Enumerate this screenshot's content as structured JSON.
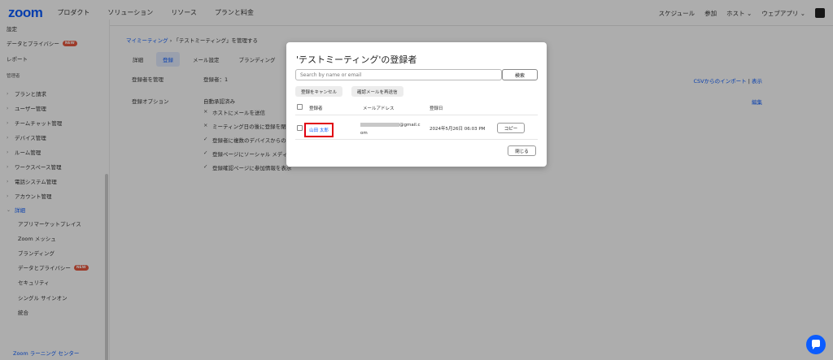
{
  "nav": {
    "logo": "zoom",
    "items": [
      "プロダクト",
      "ソリューション",
      "リソース",
      "プランと料金"
    ],
    "right": [
      "スケジュール",
      "参加",
      "ホスト ⌄",
      "ウェブアプリ ⌄"
    ]
  },
  "sidebar": {
    "top_items": [
      {
        "label": "設定"
      },
      {
        "label": "データとプライバシー",
        "badge": "NEW"
      },
      {
        "label": "レポート"
      }
    ],
    "section": "管理者",
    "admin_items": [
      "プランと請求",
      "ユーザー管理",
      "チームチャット管理",
      "デバイス管理",
      "ルーム管理",
      "ワークスペース管理",
      "電話システム管理",
      "アカウント管理"
    ],
    "advanced": "詳細",
    "advanced_items": [
      {
        "label": "アプリマーケットプレイス"
      },
      {
        "label": "Zoom メッシュ"
      },
      {
        "label": "ブランディング"
      },
      {
        "label": "データとプライバシー",
        "badge": "NEW"
      },
      {
        "label": "セキュリティ"
      },
      {
        "label": "シングル サインオン"
      },
      {
        "label": "統合"
      }
    ],
    "learning": "Zoom ラーニング センター"
  },
  "main": {
    "breadcrumb_link": "マイミーティング",
    "breadcrumb_sep": "›",
    "breadcrumb_current": "「テストミーティング」を管理する",
    "tabs": [
      "詳細",
      "登録",
      "メール設定",
      "ブランディング"
    ],
    "manage_label": "登録者を管理",
    "manage_value": "登録者：1",
    "options_label": "登録オプション",
    "options_head": "自動承認済み",
    "options": [
      {
        "mark": "×",
        "text": "ホストにメールを送信"
      },
      {
        "mark": "×",
        "text": "ミーティング日の後に登録を閉じ"
      },
      {
        "mark": "✓",
        "text": "登録者に複数のデバイスからの参"
      },
      {
        "mark": "✓",
        "text": "登録ページにソーシャル メディア"
      },
      {
        "mark": "✓",
        "text": "登録確認ページに参加情報を表示"
      }
    ],
    "csv_link": "CSVからのインポート",
    "csv_sep": "|",
    "show_link": "表示",
    "edit_link": "編集"
  },
  "modal": {
    "title": "'テストミーティング'の登録者",
    "search_placeholder": "Search by name or email",
    "search_button": "検索",
    "cancel_button": "登録をキャンセル",
    "resend_button": "確認メールを再送信",
    "headers": {
      "registrant": "登録者",
      "email": "メールアドレス",
      "date": "登録日"
    },
    "rows": [
      {
        "name": "山田 太郎",
        "email_visible": "@gmail.c",
        "email_wrap": "om",
        "date": "2024年5月26日 06:03 PM",
        "copy": "コピー"
      }
    ],
    "close_button": "閉じる"
  },
  "colors": {
    "accent": "#0b5cff",
    "highlight": "#e00012",
    "badge": "#e8573f"
  },
  "icons": {
    "chat": "chat-bubble-icon",
    "chevron": "chevron-right-icon"
  }
}
